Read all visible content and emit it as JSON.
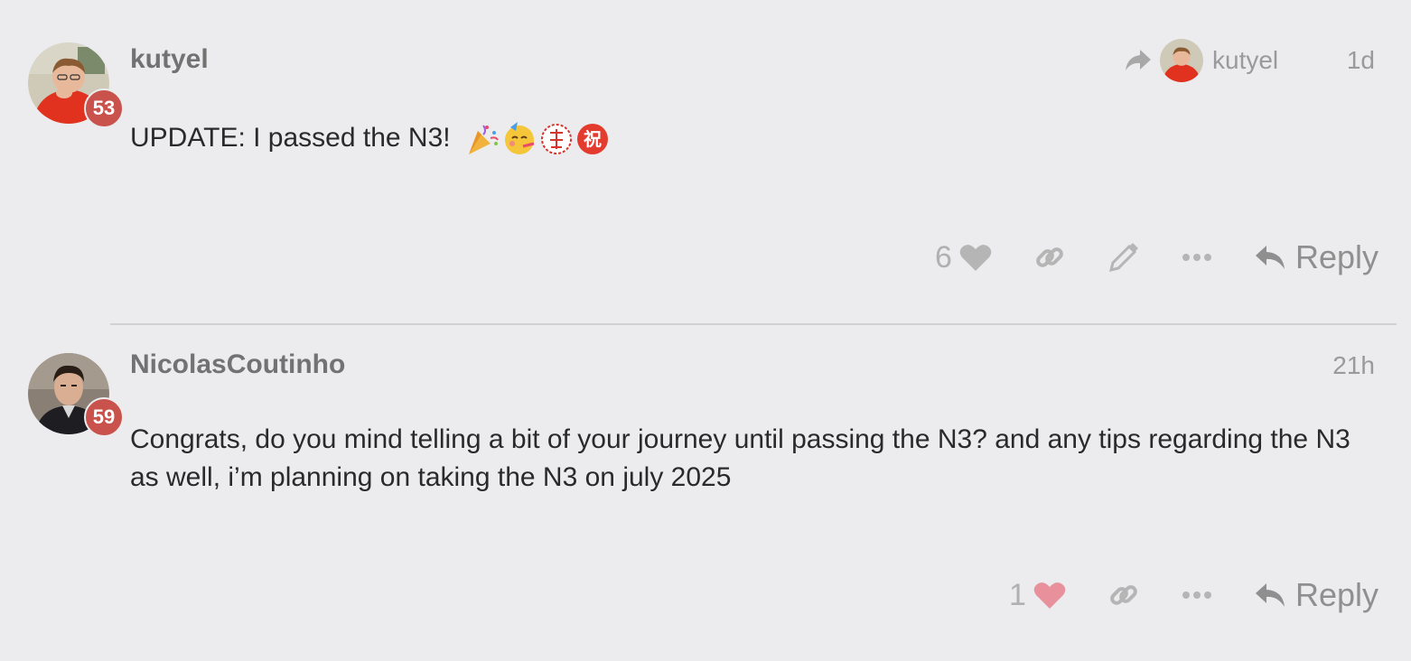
{
  "posts": [
    {
      "username": "kutyel",
      "badge": "53",
      "timestamp": "1d",
      "reply_to_user": "kutyel",
      "body": "UPDATE: I passed the N3!",
      "emojis": [
        "party-popper",
        "partying-face",
        "japanese-secret-button",
        "japanese-congratulations-button"
      ],
      "likes": "6",
      "reply_label": "Reply",
      "liked_color": "#b5b5b5"
    },
    {
      "username": "NicolasCoutinho",
      "badge": "59",
      "timestamp": "21h",
      "body": "Congrats, do you mind telling a bit of your journey until passing the N3? and any tips regarding the N3 as well, i’m planning on taking the N3 on july 2025",
      "likes": "1",
      "reply_label": "Reply",
      "liked_color": "#e8909c"
    }
  ],
  "colors": {
    "background": "#ececee",
    "badge": "#c9524c",
    "muted": "#9a9a9a",
    "heart_liked": "#e8909c"
  }
}
